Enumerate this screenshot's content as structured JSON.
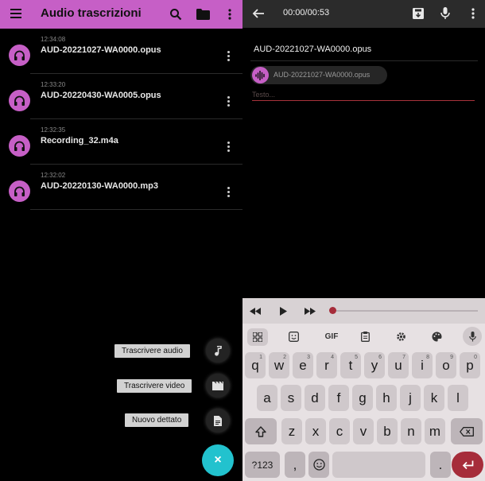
{
  "left": {
    "app_title": "Audio trascrizioni",
    "recordings": [
      {
        "time": "12:34:08",
        "name": "AUD-20221027-WA0000.opus"
      },
      {
        "time": "12:33:20",
        "name": "AUD-20220430-WA0005.opus"
      },
      {
        "time": "12:32:35",
        "name": "Recording_32.m4a"
      },
      {
        "time": "12:32:02",
        "name": "AUD-20220130-WA0000.mp3"
      }
    ],
    "fab": {
      "audio_label": "Trascrivere audio",
      "video_label": "Trascrivere video",
      "dictation_label": "Nuovo dettato",
      "close_symbol": "×"
    }
  },
  "right": {
    "timer": "00:00/00:53",
    "file_title": "AUD-20221027-WA0000.opus",
    "chip_label": "AUD-20221027-WA0000.opus",
    "text_placeholder": "Testo...",
    "player_progress": 0
  },
  "keyboard": {
    "gif_label": "GIF",
    "row1": [
      [
        "q",
        "1"
      ],
      [
        "w",
        "2"
      ],
      [
        "e",
        "3"
      ],
      [
        "r",
        "4"
      ],
      [
        "t",
        "5"
      ],
      [
        "y",
        "6"
      ],
      [
        "u",
        "7"
      ],
      [
        "i",
        "8"
      ],
      [
        "o",
        "9"
      ],
      [
        "p",
        "0"
      ]
    ],
    "row2": [
      "a",
      "s",
      "d",
      "f",
      "g",
      "h",
      "j",
      "k",
      "l"
    ],
    "row3": [
      "z",
      "x",
      "c",
      "v",
      "b",
      "n",
      "m"
    ],
    "sym_label": "?123",
    "comma": ",",
    "period": "."
  },
  "colors": {
    "accent": "#c65fc6",
    "fab": "#22c2ce",
    "progress": "#a62c3a"
  },
  "icons": {
    "left_appbar": [
      "menu-icon",
      "search-icon",
      "folder-icon",
      "more-vert-icon"
    ],
    "right_topbar": [
      "back-arrow-icon",
      "save-icon",
      "mic-icon",
      "more-vert-icon"
    ],
    "recording": "headphones-icon"
  }
}
